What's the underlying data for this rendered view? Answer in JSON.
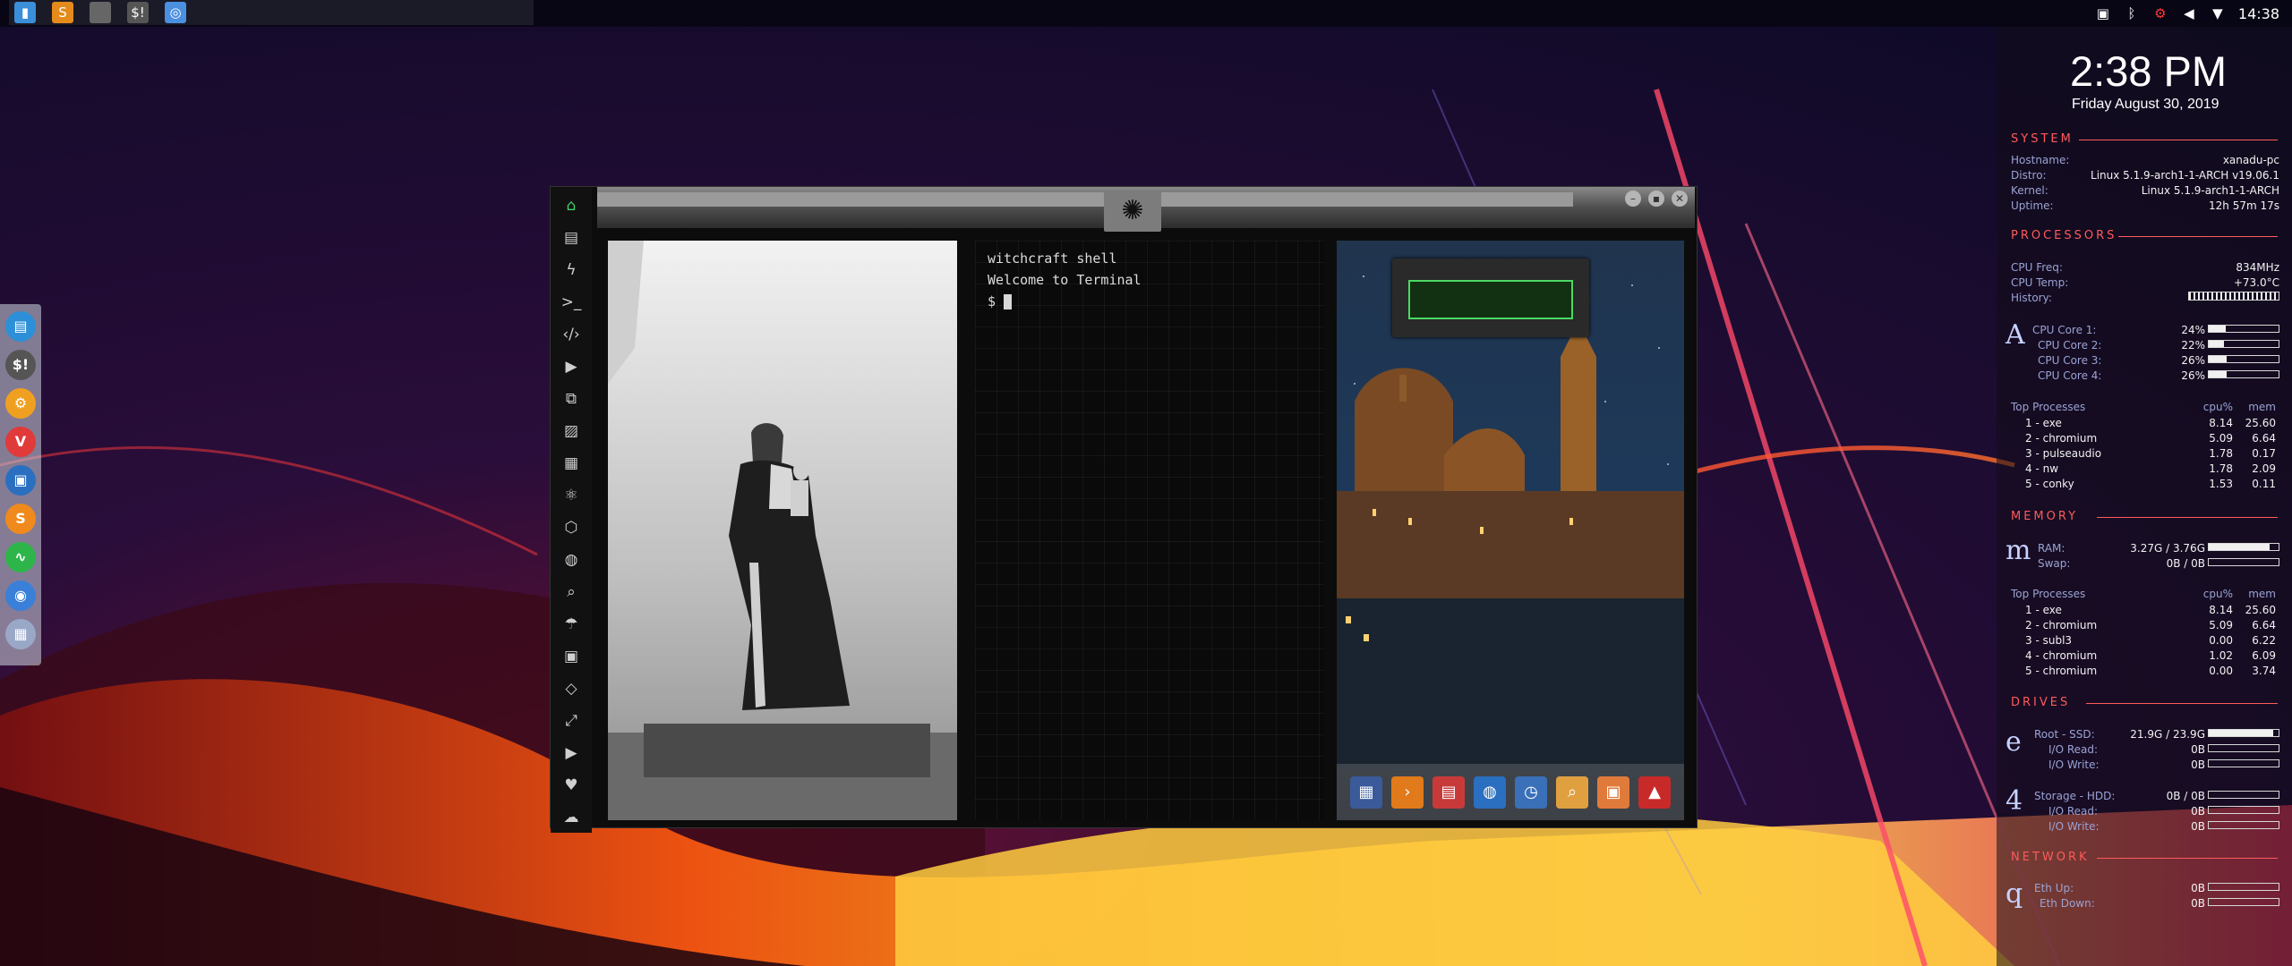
{
  "taskbar": {
    "apps": [
      {
        "icon": "folder-icon",
        "glyph": "▮",
        "color": "#3a8fd8"
      },
      {
        "icon": "sublime-icon",
        "glyph": "S",
        "color": "#e48b1c"
      },
      {
        "icon": "blank-app-icon",
        "glyph": "",
        "color": "#666666"
      },
      {
        "icon": "si-app-icon",
        "glyph": "$!",
        "color": "#555555"
      },
      {
        "icon": "chromium-icon",
        "glyph": "◎",
        "color": "#4a8fe0"
      }
    ],
    "time": "14:38"
  },
  "dock": {
    "items": [
      {
        "icon": "files-icon",
        "glyph": "▤",
        "color": "#2d8fd8"
      },
      {
        "icon": "terminal-money-icon",
        "glyph": "$!",
        "color": "#555555"
      },
      {
        "icon": "settings-icon",
        "glyph": "⚙",
        "color": "#f0a020"
      },
      {
        "icon": "vivaldi-icon",
        "glyph": "V",
        "color": "#e03a3a"
      },
      {
        "icon": "display-icon",
        "glyph": "▣",
        "color": "#2a6fc0"
      },
      {
        "icon": "sublime-icon",
        "glyph": "S",
        "color": "#f08a1c"
      },
      {
        "icon": "monitor-icon",
        "glyph": "∿",
        "color": "#2db54a"
      },
      {
        "icon": "chromium-icon",
        "glyph": "◉",
        "color": "#3a80d8"
      },
      {
        "icon": "grid-icon",
        "glyph": "▦",
        "color": "#9aa8c8"
      }
    ]
  },
  "window": {
    "sidebar": [
      {
        "icon": "home-icon",
        "glyph": "⌂"
      },
      {
        "icon": "document-icon",
        "glyph": "▤"
      },
      {
        "icon": "bolt-icon",
        "glyph": "ϟ"
      },
      {
        "icon": "terminal-icon",
        "glyph": ">_"
      },
      {
        "icon": "code-icon",
        "glyph": "‹/›"
      },
      {
        "icon": "play-icon",
        "glyph": "▶"
      },
      {
        "icon": "copy-icon",
        "glyph": "⧉"
      },
      {
        "icon": "image-icon",
        "glyph": "▨"
      },
      {
        "icon": "newspaper-icon",
        "glyph": "▦"
      },
      {
        "icon": "atom-icon",
        "glyph": "⚛"
      },
      {
        "icon": "hexagon-icon",
        "glyph": "⬡"
      },
      {
        "icon": "globe-icon",
        "glyph": "◍"
      },
      {
        "icon": "search-icon",
        "glyph": "⌕"
      },
      {
        "icon": "umbrella-icon",
        "glyph": "☂"
      },
      {
        "icon": "contact-icon",
        "glyph": "▣"
      },
      {
        "icon": "tag-icon",
        "glyph": "◇"
      },
      {
        "icon": "expand-icon",
        "glyph": "⤢"
      },
      {
        "icon": "youtube-icon",
        "glyph": "▶"
      },
      {
        "icon": "heart-icon",
        "glyph": "♥"
      },
      {
        "icon": "cloud-icon",
        "glyph": "☁"
      }
    ],
    "emblem": "rebel-alliance-icon",
    "terminal": {
      "lines": [
        "witchcraft shell",
        "Welcome to Terminal"
      ],
      "prompt": "$"
    },
    "city_dock": [
      {
        "icon": "calculator-icon",
        "glyph": "▦",
        "color": "#3a5a9a"
      },
      {
        "icon": "terminal-icon",
        "glyph": "›",
        "color": "#e07a1a"
      },
      {
        "icon": "calendar-icon",
        "glyph": "▤",
        "color": "#c83a3a"
      },
      {
        "icon": "globe-icon",
        "glyph": "◍",
        "color": "#2a6fc0"
      },
      {
        "icon": "clock-icon",
        "glyph": "◷",
        "color": "#3a70b8"
      },
      {
        "icon": "search-icon",
        "glyph": "⌕",
        "color": "#e0a040"
      },
      {
        "icon": "image-viewer-icon",
        "glyph": "▣",
        "color": "#e07a3a"
      },
      {
        "icon": "up-arrow-icon",
        "glyph": "▲",
        "color": "#c82a2a"
      }
    ]
  },
  "conky": {
    "time": "2:38 PM",
    "date": "Friday August 30, 2019",
    "system": {
      "title": "SYSTEM",
      "hostname_label": "Hostname:",
      "hostname": "xanadu-pc",
      "distro_label": "Distro:",
      "distro": "Linux 5.1.9-arch1-1-ARCH v19.06.1",
      "kernel_label": "Kernel:",
      "kernel": "Linux 5.1.9-arch1-1-ARCH",
      "uptime_label": "Uptime:",
      "uptime": "12h 57m 17s"
    },
    "processors": {
      "title": "PROCESSORS",
      "freq_label": "CPU Freq:",
      "freq": "834MHz",
      "temp_label": "CPU Temp:",
      "temp": "+73.0°C",
      "history_label": "History:",
      "glyph": "A",
      "cores": [
        {
          "label": "CPU Core 1:",
          "value": "24%",
          "pct": 24
        },
        {
          "label": "CPU Core 2:",
          "value": "22%",
          "pct": 22
        },
        {
          "label": "CPU Core 3:",
          "value": "26%",
          "pct": 26
        },
        {
          "label": "CPU Core 4:",
          "value": "26%",
          "pct": 26
        }
      ],
      "top_label": "Top Processes",
      "col_cpu": "cpu%",
      "col_mem": "mem",
      "top": [
        {
          "name": "1 - exe",
          "cpu": "8.14",
          "mem": "25.60"
        },
        {
          "name": "2 - chromium",
          "cpu": "5.09",
          "mem": "6.64"
        },
        {
          "name": "3 - pulseaudio",
          "cpu": "1.78",
          "mem": "0.17"
        },
        {
          "name": "4 - nw",
          "cpu": "1.78",
          "mem": "2.09"
        },
        {
          "name": "5 - conky",
          "cpu": "1.53",
          "mem": "0.11"
        }
      ]
    },
    "memory": {
      "title": "MEMORY",
      "glyph": "m",
      "ram_label": "RAM:",
      "ram": "3.27G / 3.76G",
      "ram_pct": 87,
      "swap_label": "Swap:",
      "swap": "0B / 0B",
      "swap_pct": 0,
      "top_label": "Top Processes",
      "col_cpu": "cpu%",
      "col_mem": "mem",
      "top": [
        {
          "name": "1 - exe",
          "cpu": "8.14",
          "mem": "25.60"
        },
        {
          "name": "2 - chromium",
          "cpu": "5.09",
          "mem": "6.64"
        },
        {
          "name": "3 - subl3",
          "cpu": "0.00",
          "mem": "6.22"
        },
        {
          "name": "4 - chromium",
          "cpu": "1.02",
          "mem": "6.09"
        },
        {
          "name": "5 - chromium",
          "cpu": "0.00",
          "mem": "3.74"
        }
      ]
    },
    "drives": {
      "title": "DRIVES",
      "root_glyph": "e",
      "root_label": "Root - SSD:",
      "root": "21.9G / 23.9G",
      "root_pct": 92,
      "root_read_label": "I/O Read:",
      "root_read": "0B",
      "root_write_label": "I/O Write:",
      "root_write": "0B",
      "storage_glyph": "4",
      "storage_label": "Storage - HDD:",
      "storage": "0B / 0B",
      "storage_pct": 0,
      "storage_read_label": "I/O Read:",
      "storage_read": "0B",
      "storage_write_label": "I/O Write:",
      "storage_write": "0B"
    },
    "network": {
      "title": "NETWORK",
      "glyph": "q",
      "up_label": "Eth Up:",
      "up": "0B",
      "down_label": "Eth Down:",
      "down": "0B"
    }
  }
}
